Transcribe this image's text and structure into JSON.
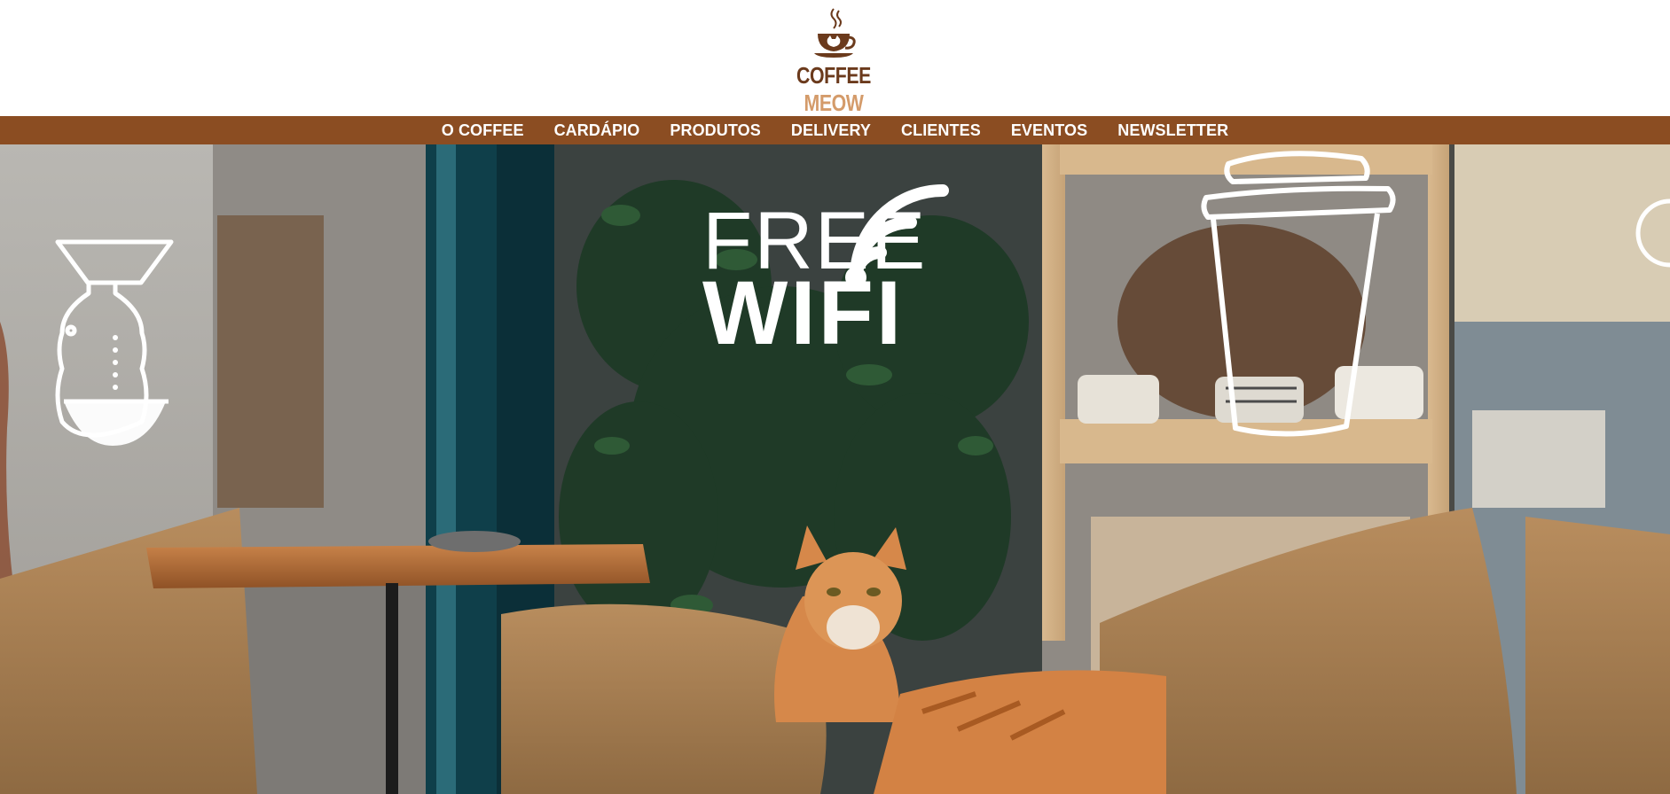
{
  "brand": {
    "name_part1": "COFFEE",
    "name_part2": "MEOW",
    "logo_icon": "coffee-cup-with-cat-icon",
    "colors": {
      "dark_brown": "#6b3a1c",
      "light_brown": "#d49b6a"
    }
  },
  "nav": {
    "background": "#8b4d22",
    "items": [
      {
        "label": "O COFFEE"
      },
      {
        "label": "CARDÁPIO"
      },
      {
        "label": "PRODUTOS"
      },
      {
        "label": "DELIVERY"
      },
      {
        "label": "CLIENTES"
      },
      {
        "label": "EVENTOS"
      },
      {
        "label": "NEWSLETTER"
      }
    ]
  },
  "hero": {
    "window_decal_line1": "FREE",
    "window_decal_line2": "WIFI",
    "icons": [
      "chemex-icon",
      "wifi-icon",
      "takeaway-cup-icon"
    ]
  }
}
